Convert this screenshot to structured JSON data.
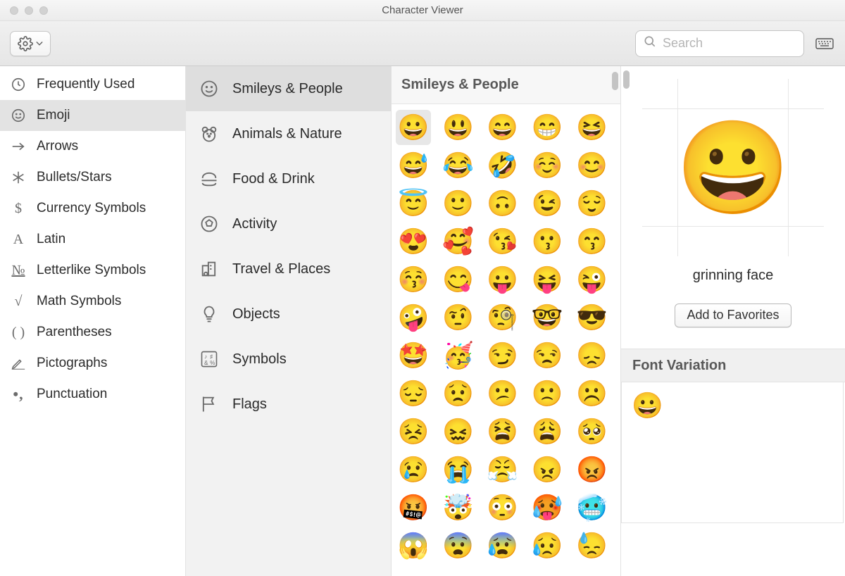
{
  "window": {
    "title": "Character Viewer"
  },
  "toolbar": {
    "search_placeholder": "Search"
  },
  "sidebar": {
    "items": [
      {
        "label": "Frequently Used"
      },
      {
        "label": "Emoji"
      },
      {
        "label": "Arrows"
      },
      {
        "label": "Bullets/Stars"
      },
      {
        "label": "Currency Symbols"
      },
      {
        "label": "Latin"
      },
      {
        "label": "Letterlike Symbols"
      },
      {
        "label": "Math Symbols"
      },
      {
        "label": "Parentheses"
      },
      {
        "label": "Pictographs"
      },
      {
        "label": "Punctuation"
      }
    ],
    "selected_index": 1
  },
  "subcategories": {
    "items": [
      {
        "label": "Smileys & People"
      },
      {
        "label": "Animals & Nature"
      },
      {
        "label": "Food & Drink"
      },
      {
        "label": "Activity"
      },
      {
        "label": "Travel & Places"
      },
      {
        "label": "Objects"
      },
      {
        "label": "Symbols"
      },
      {
        "label": "Flags"
      }
    ],
    "selected_index": 0
  },
  "grid": {
    "heading": "Smileys & People",
    "selected_index": 0,
    "emojis": [
      "😀",
      "😃",
      "😄",
      "😁",
      "😆",
      "😅",
      "😂",
      "🤣",
      "☺️",
      "😊",
      "😇",
      "🙂",
      "🙃",
      "😉",
      "😌",
      "😍",
      "🥰",
      "😘",
      "😗",
      "😙",
      "😚",
      "😋",
      "😛",
      "😝",
      "😜",
      "🤪",
      "🤨",
      "🧐",
      "🤓",
      "😎",
      "🤩",
      "🥳",
      "😏",
      "😒",
      "😞",
      "😔",
      "😟",
      "😕",
      "🙁",
      "☹️",
      "😣",
      "😖",
      "😫",
      "😩",
      "🥺",
      "😢",
      "😭",
      "😤",
      "😠",
      "😡",
      "🤬",
      "🤯",
      "😳",
      "🥵",
      "🥶",
      "😱",
      "😨",
      "😰",
      "😥",
      "😓"
    ]
  },
  "detail": {
    "preview_emoji": "😀",
    "char_name": "grinning face",
    "favorites_label": "Add to Favorites",
    "font_variation_label": "Font Variation",
    "variation_emoji": "😀"
  }
}
